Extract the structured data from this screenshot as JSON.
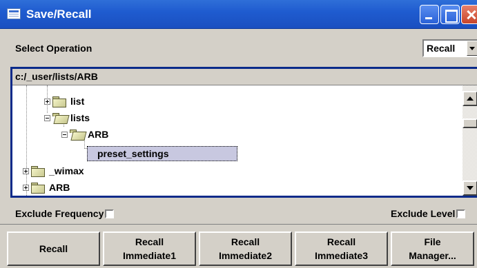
{
  "window": {
    "title": "Save/Recall"
  },
  "operation": {
    "label": "Select Operation",
    "selected": "Recall"
  },
  "file_browser": {
    "path": "c:/_user/lists/ARB",
    "tree": [
      {
        "label": "list",
        "expander": "+",
        "icon": "folder-icon"
      },
      {
        "label": "lists",
        "expander": "-",
        "icon": "folder-open-icon"
      },
      {
        "label": "ARB",
        "expander": "-",
        "icon": "folder-open-icon"
      },
      {
        "label": "preset_settings",
        "selected": true
      },
      {
        "label": "_wimax",
        "expander": "+",
        "icon": "folder-icon"
      },
      {
        "label": "ARB",
        "expander": "+",
        "icon": "folder-icon"
      }
    ]
  },
  "options": {
    "exclude_frequency": "Exclude Frequency",
    "exclude_level": "Exclude Level"
  },
  "buttons": {
    "recall": "Recall",
    "recall_immediate1": [
      "Recall",
      "Immediate1"
    ],
    "recall_immediate2": [
      "Recall",
      "Immediate2"
    ],
    "recall_immediate3": [
      "Recall",
      "Immediate3"
    ],
    "file_manager": [
      "File",
      "Manager..."
    ]
  }
}
